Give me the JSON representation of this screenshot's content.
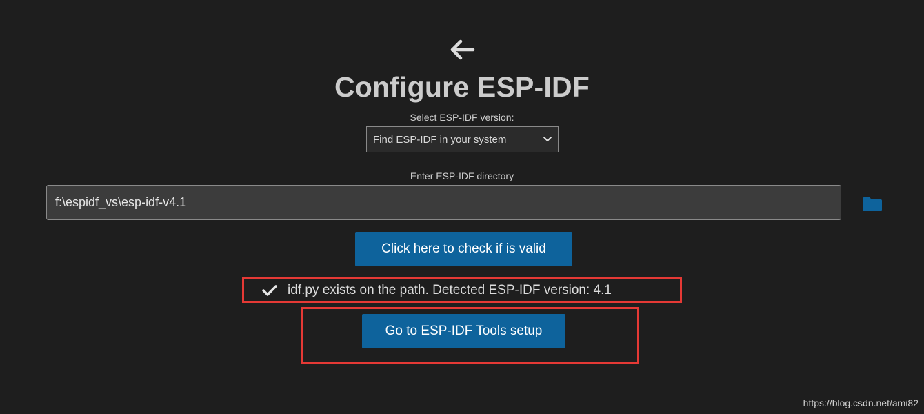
{
  "header": {
    "back_icon": "arrow-left-icon",
    "title": "Configure ESP-IDF"
  },
  "version": {
    "label": "Select ESP-IDF version:",
    "selected": "Find ESP-IDF in your system",
    "dropdown_icon": "chevron-down-icon"
  },
  "directory": {
    "label": "Enter ESP-IDF directory",
    "value": "f:\\espidf_vs\\esp-idf-v4.1",
    "folder_icon": "folder-icon"
  },
  "actions": {
    "check_label": "Click here to check if is valid",
    "tools_label": "Go to ESP-IDF Tools setup"
  },
  "status": {
    "icon": "check-icon",
    "message": "idf.py exists on the path. Detected ESP-IDF version: 4.1"
  },
  "watermark": "https://blog.csdn.net/ami82",
  "colors": {
    "background": "#1e1e1e",
    "button": "#0e639c",
    "folder": "#0e639c",
    "highlight": "#e53935"
  }
}
